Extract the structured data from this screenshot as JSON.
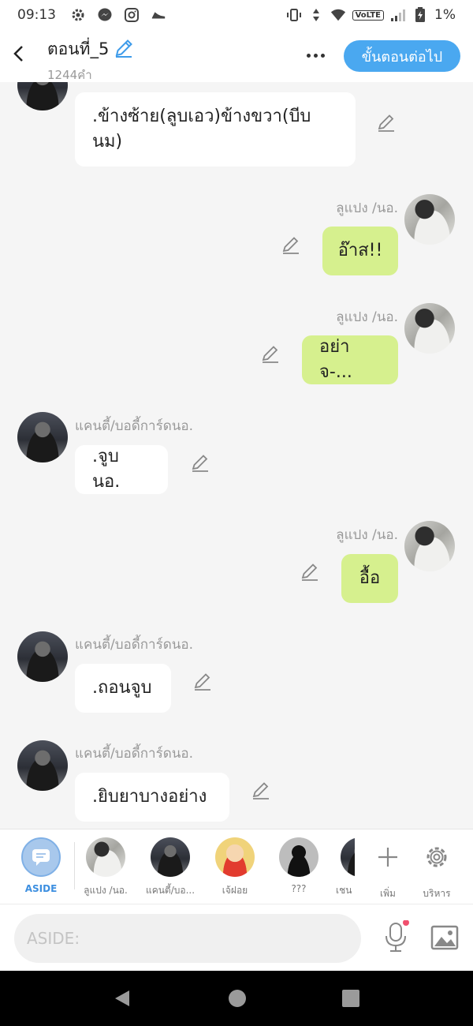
{
  "status_bar": {
    "time": "09:13",
    "volte": "VoLTE",
    "battery": "1%"
  },
  "header": {
    "title": "ตอนที่_5",
    "word_count": "1244คำ",
    "next_button": "ขั้นตอนต่อไป"
  },
  "messages": [
    {
      "side": "left",
      "sender": "",
      "text": ".ข้างซ้าย(ลูบเอว)ข้างขวา(บีบ\nนม)"
    },
    {
      "side": "right",
      "sender": "ลูแปง /นอ.",
      "text": "อ๊าส!!"
    },
    {
      "side": "right",
      "sender": "ลูแปง /นอ.",
      "text": "อย่าจ-..."
    },
    {
      "side": "left",
      "sender": "แคนตี้/บอดี้การ์ดนอ.",
      "text": ".จูบ นอ."
    },
    {
      "side": "right",
      "sender": "ลูแปง /นอ.",
      "text": "อื้อ"
    },
    {
      "side": "left",
      "sender": "แคนตี้/บอดี้การ์ดนอ.",
      "text": ".ถอนจูบ"
    },
    {
      "side": "left",
      "sender": "แคนตี้/บอดี้การ์ดนอ.",
      "text": ".ยิบยาบางอย่าง"
    }
  ],
  "cast": {
    "aside_label": "ASIDE",
    "members": [
      "ลูแปง /นอ.",
      "แคนตี้/บอ...",
      "เจ้ฝอย",
      "???",
      "เชน"
    ],
    "add_label": "เพิ่ม",
    "manage_label": "บริหาร"
  },
  "input": {
    "placeholder": "ASIDE:"
  },
  "colors": {
    "accent": "#4aa8f0",
    "bubble_right": "#d6f08e",
    "bubble_left": "#ffffff",
    "background": "#f5f5f5"
  }
}
